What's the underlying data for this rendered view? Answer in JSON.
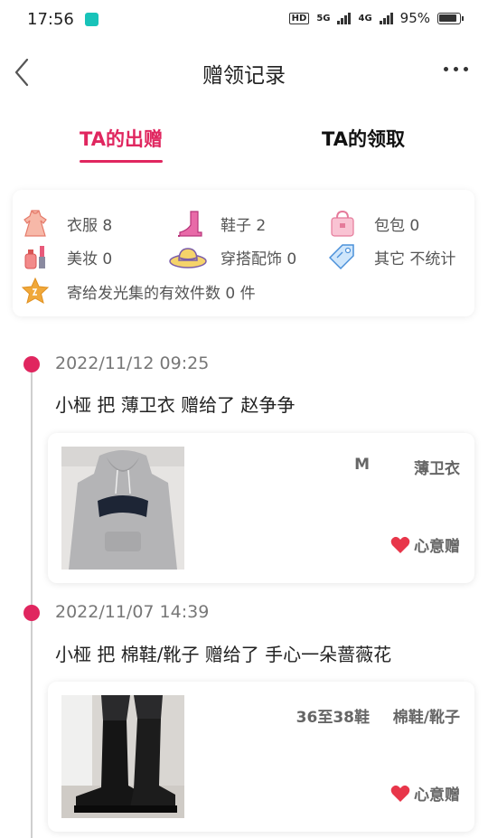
{
  "status_bar": {
    "time": "17:56",
    "hd": "HD",
    "net1": "5G",
    "net2": "4G",
    "battery": "95%"
  },
  "nav": {
    "title": "赠领记录"
  },
  "tabs": [
    {
      "label": "TA的出赠",
      "active": true
    },
    {
      "label": "TA的领取",
      "active": false
    }
  ],
  "summary": {
    "categories": [
      {
        "icon": "dress-icon",
        "label": "衣服 8"
      },
      {
        "icon": "boot-icon",
        "label": "鞋子 2"
      },
      {
        "icon": "bag-icon",
        "label": "包包 0"
      },
      {
        "icon": "makeup-icon",
        "label": "美妆 0"
      },
      {
        "icon": "hat-icon",
        "label": "穿搭配饰 0"
      },
      {
        "icon": "tag-icon",
        "label": "其它 不统计"
      }
    ],
    "shine_label": "寄给发光集的有效件数 0 件",
    "shine_icon": "star-icon"
  },
  "records": [
    {
      "date": "2022/11/12 09:25",
      "desc": "小桠 把 薄卫衣 赠给了 赵争争",
      "size": "M",
      "item_name": "薄卫衣",
      "gift_type": "心意赠",
      "photo": "hoodie-photo"
    },
    {
      "date": "2022/11/07 14:39",
      "desc": "小桠 把 棉鞋/靴子 赠给了 手心一朵蔷薇花",
      "size": "36至38鞋",
      "item_name": "棉鞋/靴子",
      "gift_type": "心意赠",
      "photo": "boots-photo"
    }
  ],
  "colors": {
    "accent": "#e0265f",
    "heart": "#e8364a"
  }
}
